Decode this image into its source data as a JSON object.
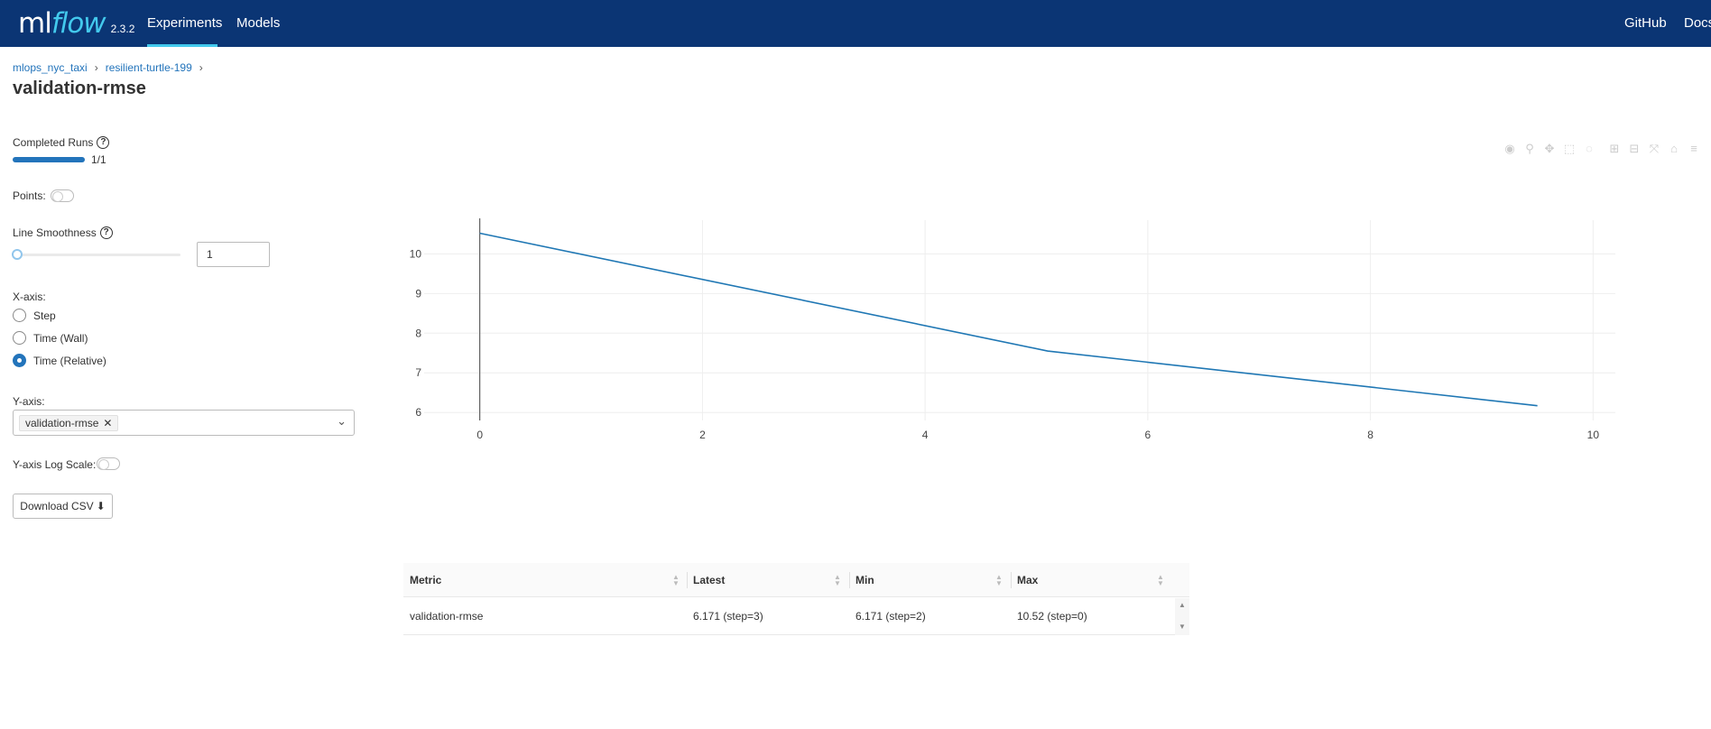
{
  "nav": {
    "logo_ml": "ml",
    "logo_flow": "flow",
    "version": "2.3.2",
    "tabs": [
      {
        "label": "Experiments",
        "active": true
      },
      {
        "label": "Models",
        "active": false
      }
    ],
    "right_links": [
      "GitHub",
      "Docs"
    ]
  },
  "breadcrumb": {
    "items": [
      "mlops_nyc_taxi",
      "resilient-turtle-199"
    ],
    "separator": "›"
  },
  "page_title": "validation-rmse",
  "controls": {
    "completed_runs_label": "Completed Runs",
    "completed_runs_value": "1/1",
    "completed_runs_fraction": 1.0,
    "points_label": "Points:",
    "points_on": false,
    "line_smoothness_label": "Line Smoothness",
    "line_smoothness_value": "1",
    "xaxis_label": "X-axis:",
    "xaxis_options": [
      {
        "label": "Step",
        "checked": false
      },
      {
        "label": "Time (Wall)",
        "checked": false
      },
      {
        "label": "Time (Relative)",
        "checked": true
      }
    ],
    "yaxis_label": "Y-axis:",
    "yaxis_selected": "validation-rmse",
    "log_scale_label": "Y-axis Log Scale:",
    "log_scale_on": false,
    "download_label": "Download CSV"
  },
  "icons": {
    "help": "?",
    "tag_close": "✕",
    "chevron": "⌄",
    "download": "⬇",
    "modebar": [
      "camera-icon",
      "zoom-icon",
      "pan-icon",
      "box-select-icon",
      "lasso-select-icon",
      "zoom-in-icon",
      "zoom-out-icon",
      "autoscale-icon",
      "reset-axes-icon",
      "toggle-spike-icon"
    ]
  },
  "colors": {
    "nav_bg": "#0b3574",
    "accent": "#43c9ed",
    "link": "#2374bb",
    "line": "#1f77b4"
  },
  "chart_data": {
    "type": "line",
    "x": [
      0,
      5.1,
      9.5
    ],
    "series": [
      {
        "x": [
          0,
          5.1,
          9.5
        ],
        "values": [
          10.52,
          7.55,
          6.171
        ]
      }
    ],
    "xlim": [
      -0.5,
      10.2
    ],
    "ylim": [
      5.8,
      10.85
    ],
    "xticks": [
      0,
      2,
      4,
      6,
      8,
      10
    ],
    "yticks": [
      6,
      7,
      8,
      9,
      10
    ],
    "grid": true,
    "legend": "none"
  },
  "table": {
    "headers": [
      "Metric",
      "Latest",
      "Min",
      "Max"
    ],
    "rows": [
      [
        "validation-rmse",
        "6.171 (step=3)",
        "6.171 (step=2)",
        "10.52 (step=0)"
      ]
    ]
  }
}
